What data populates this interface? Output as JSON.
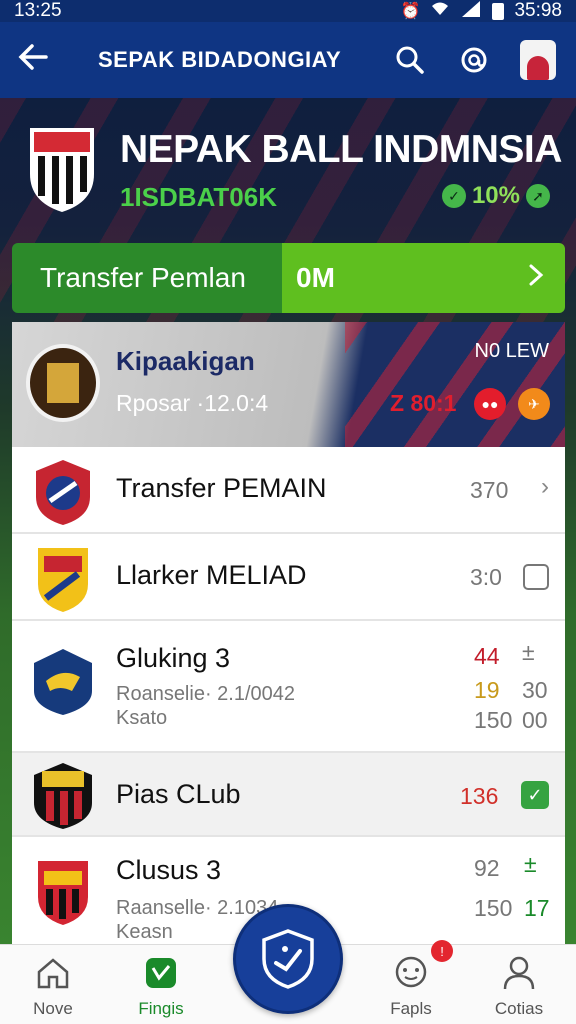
{
  "status_bar": {
    "time": "13:25",
    "clock_right": "35:98"
  },
  "app_bar": {
    "title": "SEPAK BIDADONGIAY"
  },
  "hero": {
    "title": "NEPAK BALL INDMNSIA",
    "subtitle": "1ISDBAT06K",
    "percent": "10%"
  },
  "transfer_bar": {
    "label": "Transfer Pemlan",
    "value": "0M"
  },
  "featured": {
    "name": "Kipaakigan",
    "meta": "Rposar ·12.0:4",
    "badge": "N0 LEW",
    "stat": "Z 80:1"
  },
  "rows": [
    {
      "name": "Transfer PEMAIN",
      "value": "370"
    },
    {
      "name": "Llarker MELIAD",
      "value": "3:0"
    },
    {
      "name": "Gluking 3",
      "sub1": "Roanselie· 2.1/0042",
      "sub2": "Ksato",
      "v1": "44",
      "v2": "19",
      "v3": "150",
      "w2": "30",
      "w3": "00"
    },
    {
      "name": "Pias CLub",
      "value": "136"
    },
    {
      "name": "Clusus 3",
      "sub1": "Raanselle· 2.1034",
      "sub2": "Keasn",
      "v1": "92",
      "v2": "150",
      "w2": "17"
    }
  ],
  "bottom_nav": [
    {
      "label": "Nove"
    },
    {
      "label": "Fingis"
    },
    {
      "label": "Fapls"
    },
    {
      "label": "Cotias"
    }
  ],
  "colors": {
    "primary": "#0f3583",
    "accent_green": "#5fbf1f",
    "alert_red": "#e01e2e"
  }
}
